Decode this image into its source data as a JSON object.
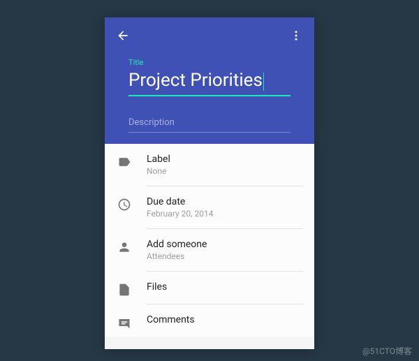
{
  "header": {
    "title_label": "Title",
    "title_value": "Project Priorities",
    "description_placeholder": "Description"
  },
  "rows": {
    "label": {
      "title": "Label",
      "sub": "None"
    },
    "due": {
      "title": "Due date",
      "sub": "February 20, 2014"
    },
    "people": {
      "title": "Add someone",
      "sub": "Attendees"
    },
    "files": {
      "title": "Files"
    },
    "comments": {
      "title": "Comments"
    }
  },
  "watermark": "@51CTO博客"
}
